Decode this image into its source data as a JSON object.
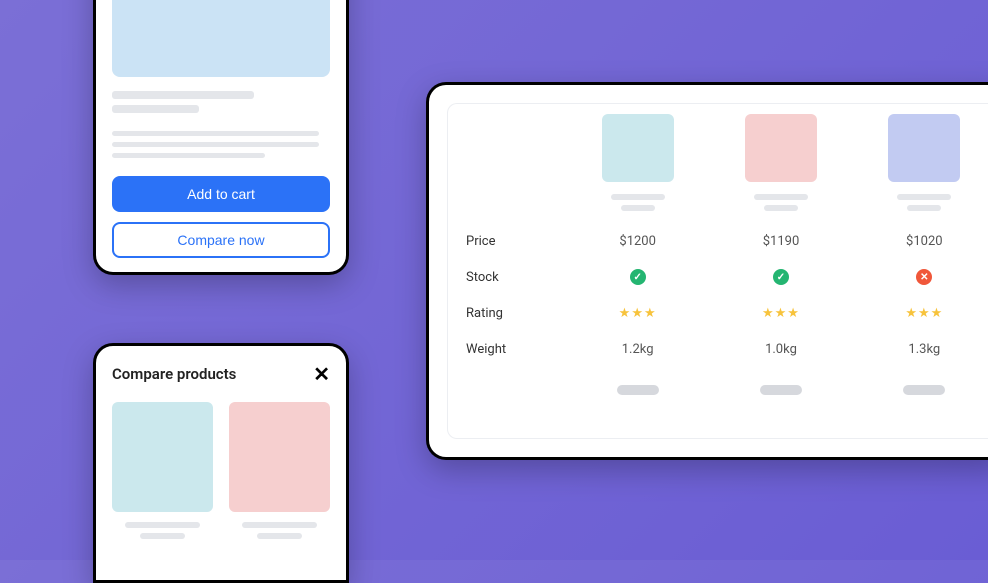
{
  "productCard": {
    "addToCartLabel": "Add to cart",
    "compareNowLabel": "Compare now"
  },
  "compareCard": {
    "title": "Compare products"
  },
  "table": {
    "rows": {
      "price": {
        "label": "Price",
        "values": [
          "$1200",
          "$1190",
          "$1020"
        ]
      },
      "stock": {
        "label": "Stock",
        "values": [
          true,
          true,
          false
        ]
      },
      "rating": {
        "label": "Rating",
        "stars": [
          3,
          3,
          3
        ]
      },
      "weight": {
        "label": "Weight",
        "values": [
          "1.2kg",
          "1.0kg",
          "1.3kg"
        ]
      }
    }
  }
}
